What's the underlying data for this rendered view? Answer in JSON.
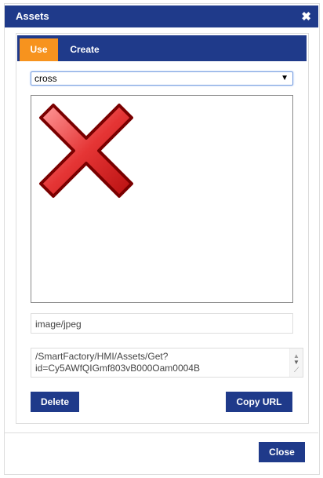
{
  "dialog": {
    "title": "Assets",
    "close_icon": "close-icon"
  },
  "tabs": [
    {
      "label": "Use",
      "active": true
    },
    {
      "label": "Create",
      "active": false
    }
  ],
  "asset_select": {
    "value": "cross"
  },
  "preview": {
    "image": "red-cross-icon"
  },
  "mime_type": "image/jpeg",
  "url": {
    "line1": "/SmartFactory/HMI/Assets/Get?",
    "line2": "id=Cy5AWfQIGmf803vB000Oam0004B"
  },
  "buttons": {
    "delete": "Delete",
    "copy_url": "Copy URL",
    "close": "Close"
  },
  "colors": {
    "primary": "#1f3a8a",
    "active_tab": "#f7931e"
  }
}
